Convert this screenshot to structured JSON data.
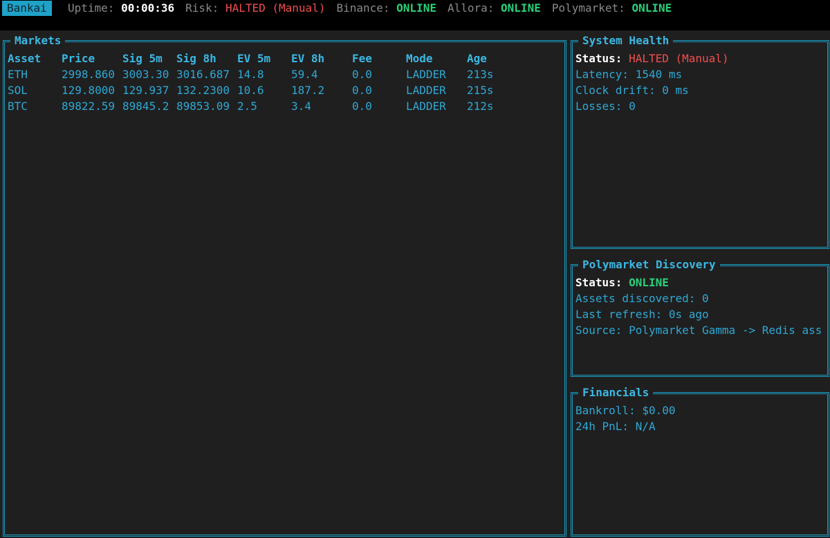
{
  "topbar": {
    "brand": "Bankai",
    "uptime_label": "Uptime:",
    "uptime_value": "00:00:36",
    "risk_label": "Risk:",
    "risk_value": "HALTED (Manual)",
    "binance_label": "Binance:",
    "binance_value": "ONLINE",
    "allora_label": "Allora:",
    "allora_value": "ONLINE",
    "polymarket_label": "Polymarket:",
    "polymarket_value": "ONLINE"
  },
  "markets": {
    "title": "Markets",
    "columns": [
      "Asset",
      "Price",
      "Sig 5m",
      "Sig 8h",
      "EV 5m",
      "EV 8h",
      "Fee",
      "Mode",
      "Age"
    ],
    "rows": [
      [
        "ETH",
        "2998.860",
        "3003.30",
        "3016.687",
        "14.8",
        "59.4",
        "0.0",
        "LADDER",
        "213s"
      ],
      [
        "SOL",
        "129.8000",
        "129.937",
        "132.2300",
        "10.6",
        "187.2",
        "0.0",
        "LADDER",
        "215s"
      ],
      [
        "BTC",
        "89822.59",
        "89845.2",
        "89853.09",
        "2.5",
        "3.4",
        "0.0",
        "LADDER",
        "212s"
      ]
    ]
  },
  "system_health": {
    "title": "System Health",
    "status_label": "Status:",
    "status_value": "HALTED (Manual)",
    "latency": "Latency: 1540 ms",
    "clock_drift": "Clock drift: 0 ms",
    "losses": "Losses: 0"
  },
  "discovery": {
    "title": "Polymarket Discovery",
    "status_label": "Status:",
    "status_value": "ONLINE",
    "assets": "Assets discovered: 0",
    "last_refresh": "Last refresh: 0s ago",
    "source": "Source: Polymarket Gamma -> Redis ass"
  },
  "financials": {
    "title": "Financials",
    "bankroll": "Bankroll: $0.00",
    "pnl": "24h PnL: N/A"
  },
  "colors": {
    "accent": "#1b9ec4",
    "text": "#2fa8d4",
    "online": "#2ad07a",
    "halted": "#f24e4e",
    "panel_bg": "#1f1f1f"
  }
}
